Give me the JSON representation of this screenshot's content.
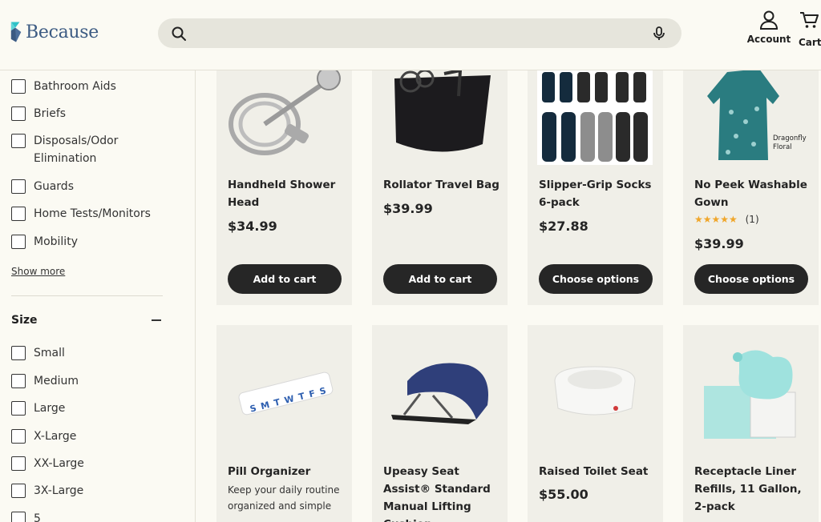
{
  "header": {
    "logo_text": "Because",
    "search_placeholder": "",
    "account_label": "Account",
    "cart_label": "Cart"
  },
  "sidebar": {
    "categories": [
      {
        "label": "Bathroom Aids",
        "checked": false
      },
      {
        "label": "Briefs",
        "checked": false
      },
      {
        "label": "Disposals/Odor Elimination",
        "checked": false
      },
      {
        "label": "Guards",
        "checked": false
      },
      {
        "label": "Home Tests/Monitors",
        "checked": false
      },
      {
        "label": "Mobility",
        "checked": false
      }
    ],
    "show_more": "Show more",
    "size_heading": "Size",
    "sizes": [
      {
        "label": "Small",
        "checked": false
      },
      {
        "label": "Medium",
        "checked": false
      },
      {
        "label": "Large",
        "checked": false
      },
      {
        "label": "X-Large",
        "checked": false
      },
      {
        "label": "XX-Large",
        "checked": false
      },
      {
        "label": "3X-Large",
        "checked": false
      },
      {
        "label": "5",
        "checked": false
      }
    ]
  },
  "products": [
    {
      "title": "Handheld Shower Head",
      "price": "$34.99",
      "button": "Add to cart",
      "icon": "shower-head-image"
    },
    {
      "title": "Rollator Travel Bag",
      "price": "$39.99",
      "button": "Add to cart",
      "icon": "travel-bag-image"
    },
    {
      "title": "Slipper-Grip Socks 6-pack",
      "price": "$27.88",
      "button": "Choose options",
      "icon": "socks-image"
    },
    {
      "title": "No Peek Washable Gown",
      "price": "$39.99",
      "button": "Choose options",
      "rating_stars": "★★★★★",
      "rating_count": "(1)",
      "image_caption": "Dragonfly Floral",
      "icon": "gown-image"
    },
    {
      "title": "Pill Organizer",
      "description": "Keep your daily routine organized and simple",
      "icon": "pill-organizer-image",
      "pill_letters": "SMTWTFS"
    },
    {
      "title": "Upeasy Seat Assist® Standard Manual Lifting Cushion",
      "icon": "lifting-cushion-image"
    },
    {
      "title": "Raised Toilet Seat",
      "price": "$55.00",
      "icon": "toilet-seat-image"
    },
    {
      "title": "Receptacle Liner Refills, 11 Gallon, 2-pack",
      "icon": "receptacle-liner-image"
    }
  ],
  "colors": {
    "background": "#fbfaf3",
    "card_bg": "#f0efe8",
    "button_bg": "#262626",
    "logo_blue": "#3b5a82",
    "logo_teal": "#2fc2c7",
    "star": "#f0a62a"
  }
}
